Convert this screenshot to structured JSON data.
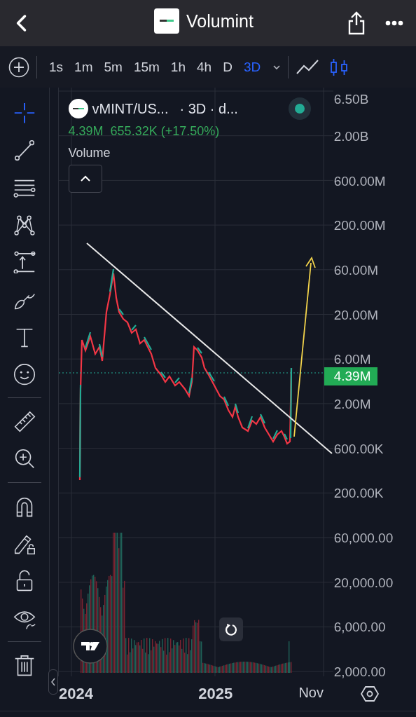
{
  "header": {
    "title": "Volumint"
  },
  "toolbar": {
    "intervals": [
      {
        "label": "1s",
        "selected": false
      },
      {
        "label": "1m",
        "selected": false
      },
      {
        "label": "5m",
        "selected": false
      },
      {
        "label": "15m",
        "selected": false
      },
      {
        "label": "1h",
        "selected": false
      },
      {
        "label": "4h",
        "selected": false
      },
      {
        "label": "D",
        "selected": false
      },
      {
        "label": "3D",
        "selected": true
      }
    ],
    "chart_types": [
      {
        "kind": "line",
        "selected": false
      },
      {
        "kind": "candles",
        "selected": true
      }
    ]
  },
  "tool_groups": [
    {
      "tools": [
        {
          "kind": "crosshair",
          "selected": true
        },
        {
          "kind": "trend-line",
          "selected": false
        },
        {
          "kind": "fib",
          "selected": false
        },
        {
          "kind": "pattern",
          "selected": false
        },
        {
          "kind": "measure",
          "selected": false
        },
        {
          "kind": "brush",
          "selected": false
        },
        {
          "kind": "text",
          "selected": false
        },
        {
          "kind": "emoji",
          "selected": false
        }
      ]
    },
    {
      "tools": [
        {
          "kind": "ruler",
          "selected": false
        },
        {
          "kind": "zoom",
          "selected": false
        }
      ]
    },
    {
      "tools": [
        {
          "kind": "magnet",
          "selected": false
        },
        {
          "kind": "lock-drawing",
          "selected": false
        },
        {
          "kind": "lock",
          "selected": false
        },
        {
          "kind": "eye",
          "selected": false
        }
      ]
    },
    {
      "tools": [
        {
          "kind": "trash",
          "selected": false
        }
      ]
    }
  ],
  "legend": {
    "symbol": "vMINT/US...",
    "details": "· 3D · d...",
    "price": "4.39M",
    "change": "655.32K (+17.50%)",
    "status_dot": {
      "color": "#22ab94"
    },
    "indicator": "Volume"
  },
  "price_axis": [
    "6.50B",
    "2.00B",
    "600.00M",
    "200.00M",
    "60.00M",
    "20.00M",
    "6.00M",
    "2.00M",
    "600.00K",
    "200.00K",
    "60,000.00",
    "20,000.00",
    "6,000.00",
    "2,000.00"
  ],
  "current_price": "4.39M",
  "time_axis": [
    "2024",
    "2025",
    "Nov"
  ]
}
